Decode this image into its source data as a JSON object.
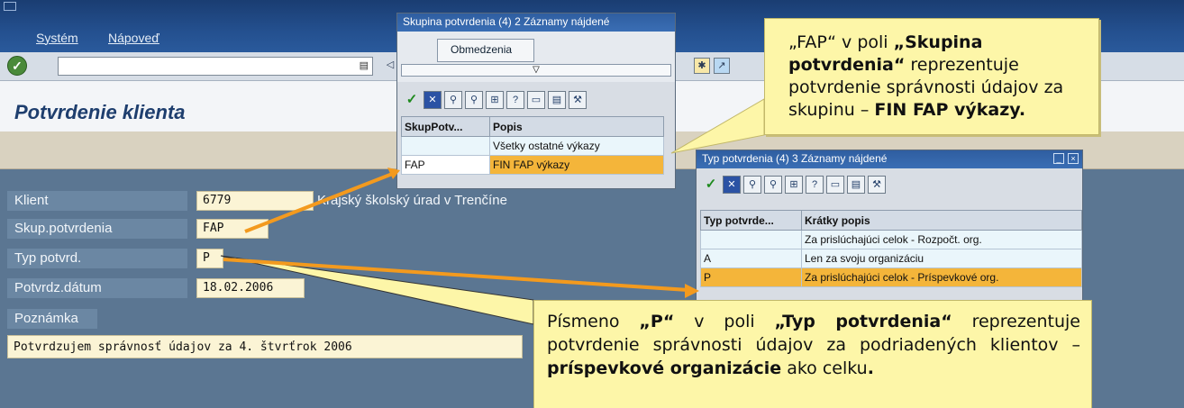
{
  "menubar": {
    "items": [
      "Systém",
      "Nápoveď"
    ]
  },
  "page_title": "Potvrdenie klienta",
  "form": {
    "fields": [
      {
        "label": "Klient",
        "value": "6779"
      },
      {
        "label": "Skup.potvrdenia",
        "value": "FAP"
      },
      {
        "label": "Typ potvrd.",
        "value": "P"
      },
      {
        "label": "Potvrdz.dátum",
        "value": "18.02.2006"
      }
    ],
    "client_desc": "Krajský školský úrad v Trenčíne",
    "note_label": "Poznámka",
    "note_value": "Potvrdzujem správnosť údajov za 4. štvrťrok 2006"
  },
  "popup_group": {
    "title": "Skupina potvrdenia (4)   2 Záznamy nájdené",
    "tab": "Obmedzenia",
    "columns": [
      "SkupPotv...",
      "Popis"
    ],
    "rows": [
      {
        "key": "",
        "desc": "Všetky ostatné výkazy",
        "selected": false
      },
      {
        "key": "FAP",
        "desc": "FIN FAP výkazy",
        "selected": true
      }
    ]
  },
  "popup_type": {
    "title": "Typ potvrdenia (4)   3 Záznamy nájdené",
    "columns": [
      "Typ potvrde...",
      "Krátky popis"
    ],
    "rows": [
      {
        "key": "",
        "desc": "Za prislúchajúci celok - Rozpočt. org.",
        "selected": false
      },
      {
        "key": "A",
        "desc": "Len za svoju organizáciu",
        "selected": false
      },
      {
        "key": "P",
        "desc": "Za prislúchajúci celok - Príspevkové org.",
        "selected": true
      }
    ]
  },
  "callout_group": {
    "t1": "„FAP“ v poli ",
    "b1": "„Skupina potvrdenia“",
    "t2": " reprezentuje potvrdenie správnosti údajov za skupinu –  ",
    "b2": "FIN FAP výkazy."
  },
  "callout_type": {
    "t1": "Písmeno ",
    "b1": "„P“",
    "t2": " v poli ",
    "b2": "„Typ potvrdenia“",
    "t3": " reprezentuje potvrdenie správnosti údajov za podriadených klientov – ",
    "b3": "príspevkové organizácie",
    "t4": " ako celku",
    "b4": "."
  },
  "colors": {
    "arrow": "#f39a1e",
    "callout": "#fdf6a8",
    "selected_row": "#f4b53a"
  }
}
